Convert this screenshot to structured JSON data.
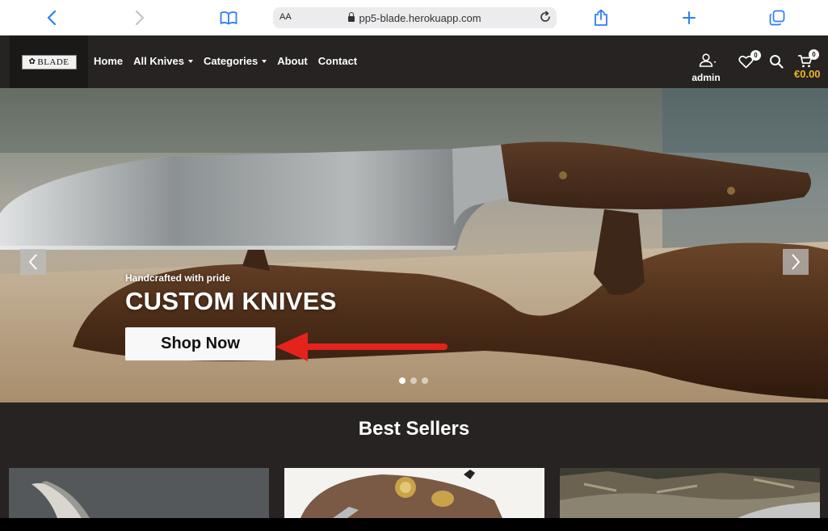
{
  "browser": {
    "text_size_label": "AA",
    "url": "pp5-blade.herokuapp.com"
  },
  "site": {
    "logo_text": "BLADE",
    "nav": {
      "home": "Home",
      "all_knives": "All Knives",
      "categories": "Categories",
      "about": "About",
      "contact": "Contact"
    },
    "account_label": "admin",
    "wishlist_count": "0",
    "cart_count": "0",
    "cart_total": "€0.00"
  },
  "hero": {
    "tagline": "Handcrafted with pride",
    "title": "CUSTOM KNIVES",
    "button_label": "Shop Now",
    "slide_count": 3,
    "active_slide": 1,
    "annotation_arrow_color": "#e3231c"
  },
  "best_sellers": {
    "title": "Best Sellers"
  },
  "colors": {
    "header_bg": "#262322",
    "accent": "#f0b41e",
    "ios_blue": "#2f7cf6"
  }
}
